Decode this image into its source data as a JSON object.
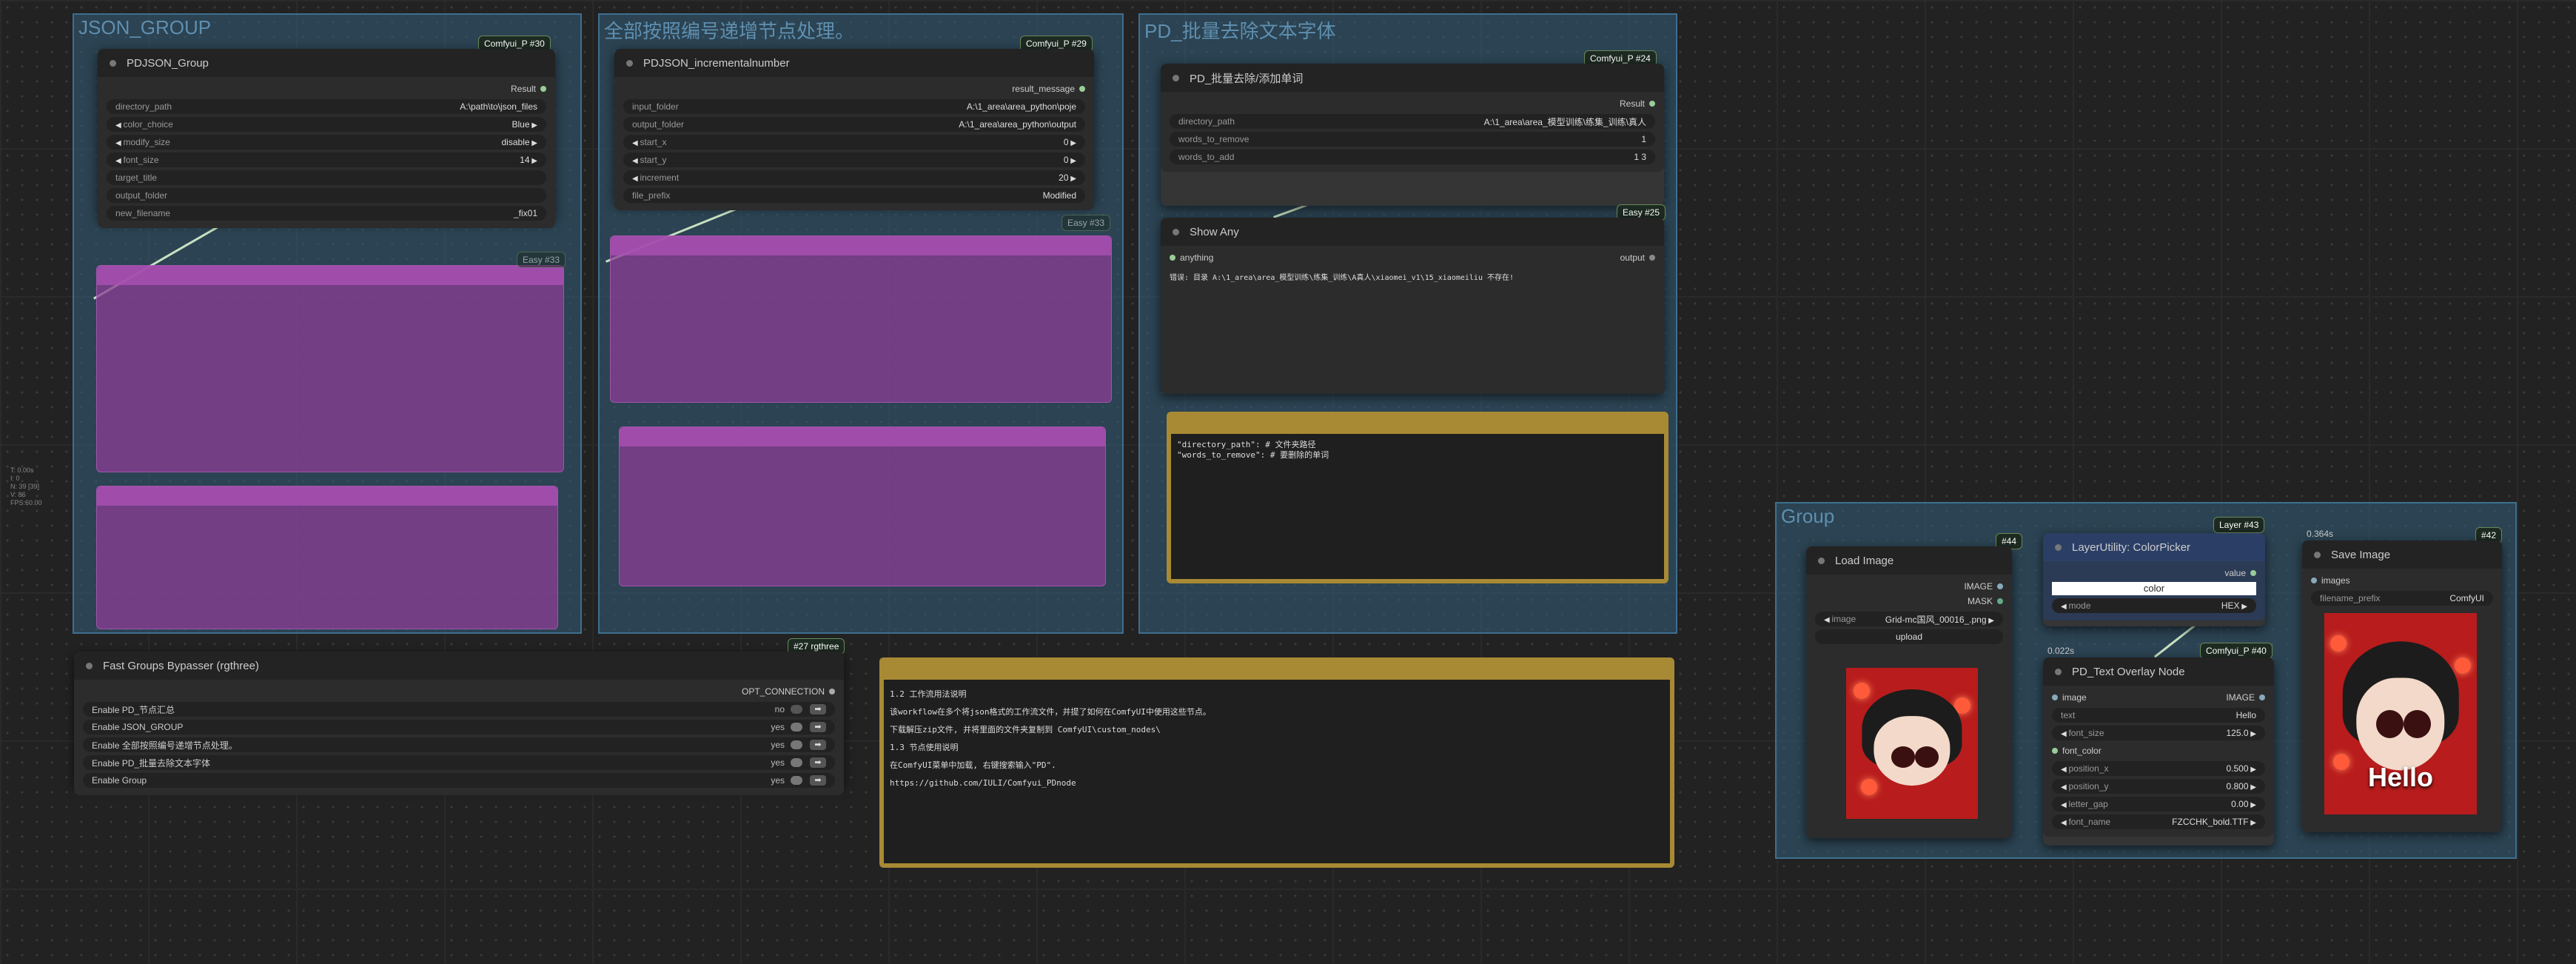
{
  "groups": {
    "json_group": "JSON_GROUP",
    "incremental": "全部按照编号递增节点处理。",
    "pd_text": "PD_批量去除文本字体",
    "group": "Group"
  },
  "pdjson_group": {
    "title": "PDJSON_Group",
    "badge": "Comfyui_P #30",
    "output": "Result",
    "widgets": [
      {
        "name": "directory_path",
        "value": "A:\\path\\to\\json_files"
      },
      {
        "name": "color_choice",
        "value": "Blue"
      },
      {
        "name": "modify_size",
        "value": "disable"
      },
      {
        "name": "font_size",
        "value": "14"
      },
      {
        "name": "target_title",
        "value": ""
      },
      {
        "name": "output_folder",
        "value": ""
      },
      {
        "name": "new_filename",
        "value": "_fix01"
      }
    ]
  },
  "pdjson_incremental": {
    "title": "PDJSON_incrementalnumber",
    "badge": "Comfyui_P #29",
    "output": "result_message",
    "widgets": [
      {
        "name": "input_folder",
        "value": "A:\\1_area\\area_python\\poje"
      },
      {
        "name": "output_folder",
        "value": "A:\\1_area\\area_python\\output"
      },
      {
        "name": "start_x",
        "value": "0"
      },
      {
        "name": "start_y",
        "value": "0"
      },
      {
        "name": "increment",
        "value": "20"
      },
      {
        "name": "file_prefix",
        "value": "Modified"
      }
    ]
  },
  "pd_remove_words": {
    "title": "PD_批量去除/添加单词",
    "badge": "Comfyui_P #24",
    "output": "Result",
    "widgets": [
      {
        "name": "directory_path",
        "value": "A:\\1_area\\area_模型训练\\练集_训练\\真人"
      },
      {
        "name": "words_to_remove",
        "value": "1"
      },
      {
        "name": "words_to_add",
        "value": "1 3"
      }
    ]
  },
  "show_any": {
    "title": "Show Any",
    "badge": "Easy #25",
    "input": "anything",
    "output": "output",
    "text": "错误: 目录 A:\\1_area\\area_模型训练\\练集_训练\\A真人\\xiaomei_v1\\15_xiaomeiliu 不存在!"
  },
  "gold_note_1": {
    "text": "\"directory_path\": # 文件夹路径\n\"words_to_remove\": # 要删除的单词"
  },
  "bypasser": {
    "title": "Fast Groups Bypasser (rgthree)",
    "badge": "#27 rgthree",
    "output": "OPT_CONNECTION",
    "rows": [
      {
        "label": "Enable PD_节点汇总",
        "state": "no"
      },
      {
        "label": "Enable JSON_GROUP",
        "state": "yes"
      },
      {
        "label": "Enable 全部按照编号递增节点处理。",
        "state": "yes"
      },
      {
        "label": "Enable PD_批量去除文本字体",
        "state": "yes"
      },
      {
        "label": "Enable Group",
        "state": "yes"
      }
    ]
  },
  "gold_note_2": {
    "text": "1.2 工作流用法说明\n该workflow在多个将json格式的工作流文件，并提了如何在ComfyUI中使用这些节点。\n下载解压zip文件, 并将里面的文件夹复制到 ComfyUI\\custom_nodes\\\n1.3 节点使用说明\n在ComfyUI菜单中加载, 右键搜索输入\"PD\".\nhttps://github.com/IULI/Comfyui_PDnode"
  },
  "load_image": {
    "title": "Load Image",
    "badge": "#44",
    "outputs": [
      "IMAGE",
      "MASK"
    ],
    "image_label": "image",
    "image_value": "Grid-mc国风_00016_.png",
    "upload": "upload"
  },
  "color_picker": {
    "title": "LayerUtility: ColorPicker",
    "badge": "Layer #43",
    "output": "value",
    "color_label": "color",
    "mode_label": "mode",
    "mode_value": "HEX"
  },
  "text_overlay": {
    "title": "PD_Text Overlay Node",
    "badge": "Comfyui_P #40",
    "time": "0.022s",
    "input": "image",
    "output": "IMAGE",
    "text_label": "text",
    "text_value": "Hello",
    "font_color": "font_color",
    "widgets": [
      {
        "name": "font_size",
        "value": "125.0"
      },
      {
        "name": "position_x",
        "value": "0.500"
      },
      {
        "name": "position_y",
        "value": "0.800"
      },
      {
        "name": "letter_gap",
        "value": "0.00"
      },
      {
        "name": "font_name",
        "value": "FZCCHK_bold.TTF"
      }
    ]
  },
  "save_image": {
    "title": "Save Image",
    "badge": "#42",
    "time": "0.364s",
    "input": "images",
    "prefix_label": "filename_prefix",
    "prefix_value": "ComfyUI",
    "overlay_text": "Hello"
  },
  "side_stats": {
    "text": "T: 0.00s\nI: 0\nN: 39 [39]\nV: 86\nFPS:60.00"
  },
  "badges": {
    "easy_note": "Easy #33",
    "easy_note2": "Easy #33"
  },
  "colors": {
    "group_fill": "#335f7a",
    "note_purple": "#8c3c96",
    "note_gold": "#a88a35",
    "wire": "#c8e0c0"
  }
}
